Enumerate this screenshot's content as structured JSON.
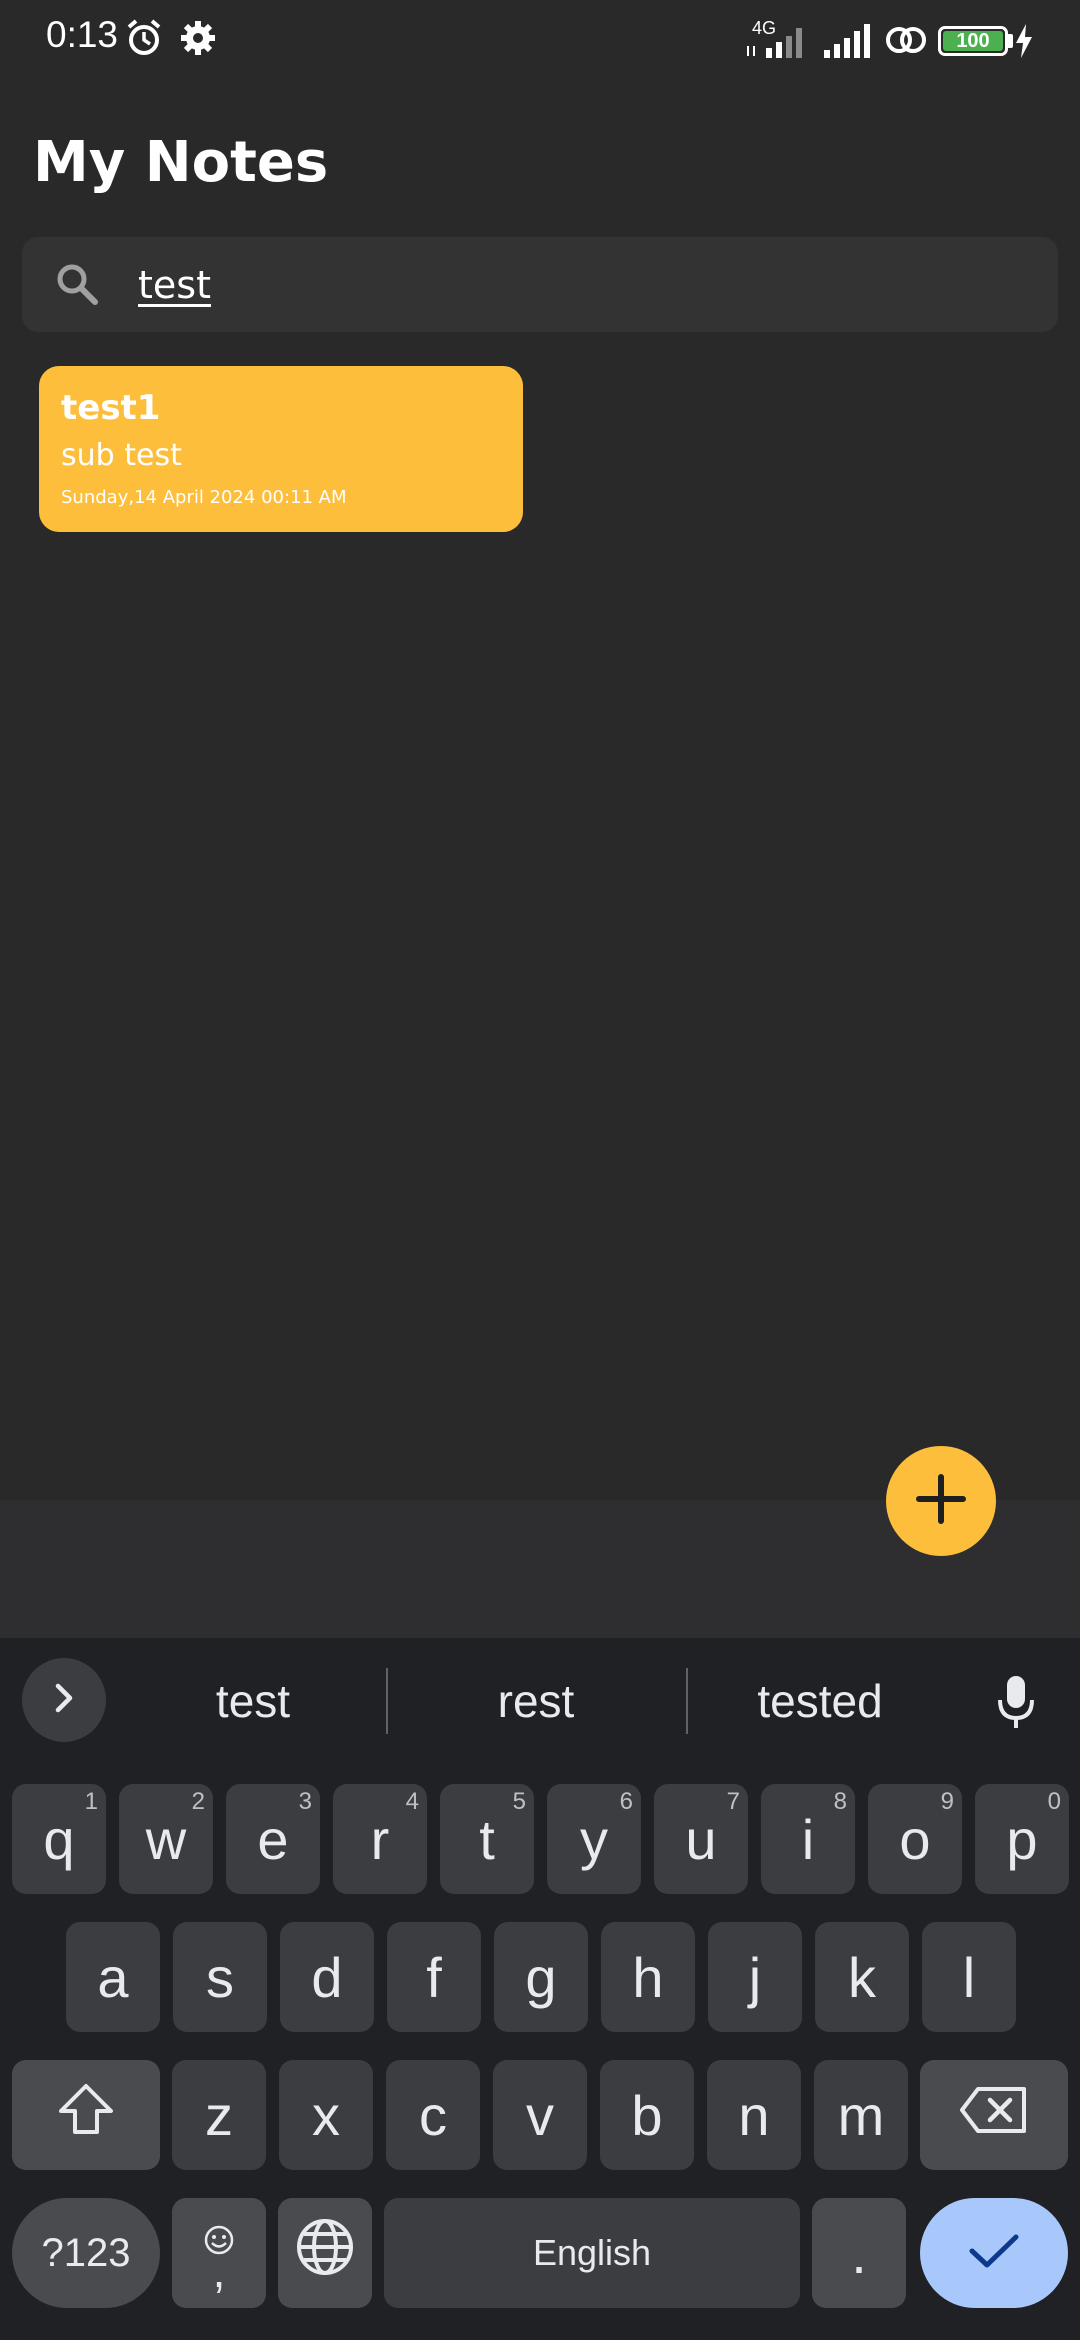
{
  "status": {
    "time": "0:13",
    "network": "4G",
    "battery": "100"
  },
  "header": {
    "title": "My Notes"
  },
  "search": {
    "value": "test"
  },
  "notes": [
    {
      "title": "test1",
      "subtitle": "sub test",
      "date": "Sunday,14 April 2024 00:11 AM",
      "color": "#FDBE3B"
    }
  ],
  "fab": {
    "icon": "plus-icon",
    "color": "#FDBE3B"
  },
  "keyboard": {
    "suggestions": [
      "test",
      "rest",
      "tested"
    ],
    "row1": [
      {
        "k": "q",
        "h": "1"
      },
      {
        "k": "w",
        "h": "2"
      },
      {
        "k": "e",
        "h": "3"
      },
      {
        "k": "r",
        "h": "4"
      },
      {
        "k": "t",
        "h": "5"
      },
      {
        "k": "y",
        "h": "6"
      },
      {
        "k": "u",
        "h": "7"
      },
      {
        "k": "i",
        "h": "8"
      },
      {
        "k": "o",
        "h": "9"
      },
      {
        "k": "p",
        "h": "0"
      }
    ],
    "row2": [
      "a",
      "s",
      "d",
      "f",
      "g",
      "h",
      "j",
      "k",
      "l"
    ],
    "row3": [
      "z",
      "x",
      "c",
      "v",
      "b",
      "n",
      "m"
    ],
    "symbols_label": "?123",
    "comma_label": ",",
    "space_label": "English",
    "period_label": "."
  }
}
